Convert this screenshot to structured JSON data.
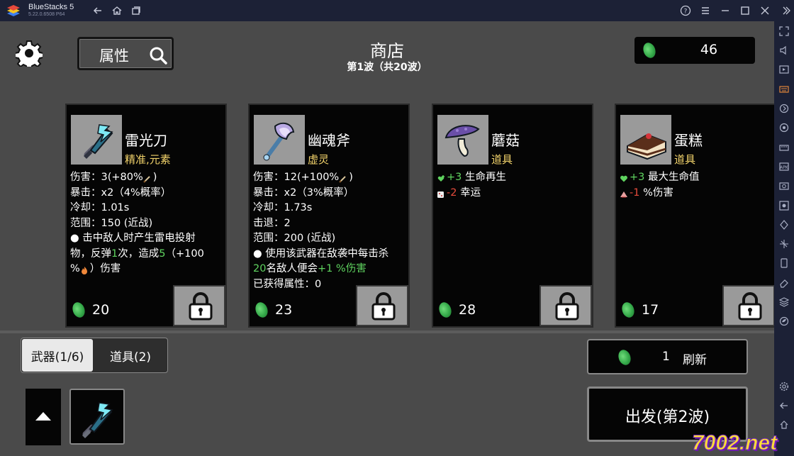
{
  "window": {
    "app_name": "BlueStacks 5",
    "version": "5.22.0.6508  P64"
  },
  "header": {
    "search_label": "属性",
    "title": "商店",
    "wave": "第1波（共20波）",
    "money": "46"
  },
  "cards": [
    {
      "name": "雷光刀",
      "tags": "精准,元素",
      "lines": [
        [
          {
            "t": "伤害：3(+80%"
          },
          {
            "icon": "sword-icon"
          },
          {
            "t": ")"
          }
        ],
        [
          {
            "t": "暴击：x2（4%概率）"
          }
        ],
        [
          {
            "t": "冷却：1.01s"
          }
        ],
        [
          {
            "t": "范围：150 (近战)"
          }
        ],
        [
          {
            "t": "● 击中敌人时产生雷电投射"
          }
        ],
        [
          {
            "t": "物，反弹"
          },
          {
            "t": "1",
            "c": "g"
          },
          {
            "t": "次，造成"
          },
          {
            "t": "5",
            "c": "g"
          },
          {
            "t": "（+100"
          }
        ],
        [
          {
            "t": "%"
          },
          {
            "icon": "flame-icon"
          },
          {
            "t": "）伤害"
          }
        ]
      ],
      "price": "20"
    },
    {
      "name": "幽魂斧",
      "tags": "虚灵",
      "lines": [
        [
          {
            "t": "伤害：12(+100%"
          },
          {
            "icon": "sword-icon"
          },
          {
            "t": ")"
          }
        ],
        [
          {
            "t": "暴击：x2（3%概率）"
          }
        ],
        [
          {
            "t": "冷却：1.73s"
          }
        ],
        [
          {
            "t": "击退：2"
          }
        ],
        [
          {
            "t": "范围：200 (近战)"
          }
        ],
        [
          {
            "t": "● 使用该武器在敌袭中每击杀"
          }
        ],
        [
          {
            "t": "20",
            "c": "g"
          },
          {
            "t": "名敌人便会"
          },
          {
            "t": "+1 %伤害",
            "c": "g"
          }
        ],
        [
          {
            "t": "已获得属性：0"
          }
        ]
      ],
      "price": "23"
    },
    {
      "name": "蘑菇",
      "tags": "道具",
      "lines": [
        [
          {
            "icon": "heal-icon"
          },
          {
            "t": "+3",
            "c": "g"
          },
          {
            "t": " 生命再生"
          }
        ],
        [
          {
            "icon": "dice-icon"
          },
          {
            "t": "-2",
            "c": "r"
          },
          {
            "t": " 幸运"
          }
        ]
      ],
      "price": "28"
    },
    {
      "name": "蛋糕",
      "tags": "道具",
      "lines": [
        [
          {
            "icon": "heart-icon"
          },
          {
            "t": "+3",
            "c": "g"
          },
          {
            "t": " 最大生命值"
          }
        ],
        [
          {
            "icon": "damage-icon"
          },
          {
            "t": "-1",
            "c": "r"
          },
          {
            "t": " %伤害"
          }
        ]
      ],
      "price": "17"
    }
  ],
  "tabs": {
    "weapons": "武器(1/6)",
    "items": "道具(2)"
  },
  "refresh": {
    "cost": "1",
    "label": "刷新"
  },
  "depart": {
    "label": "出发(第2波)"
  },
  "watermark": "7002.net",
  "colors": {
    "accent_green": "#5fd35f",
    "negative_red": "#e74c3c",
    "tag_yellow": "#f2d36b"
  }
}
